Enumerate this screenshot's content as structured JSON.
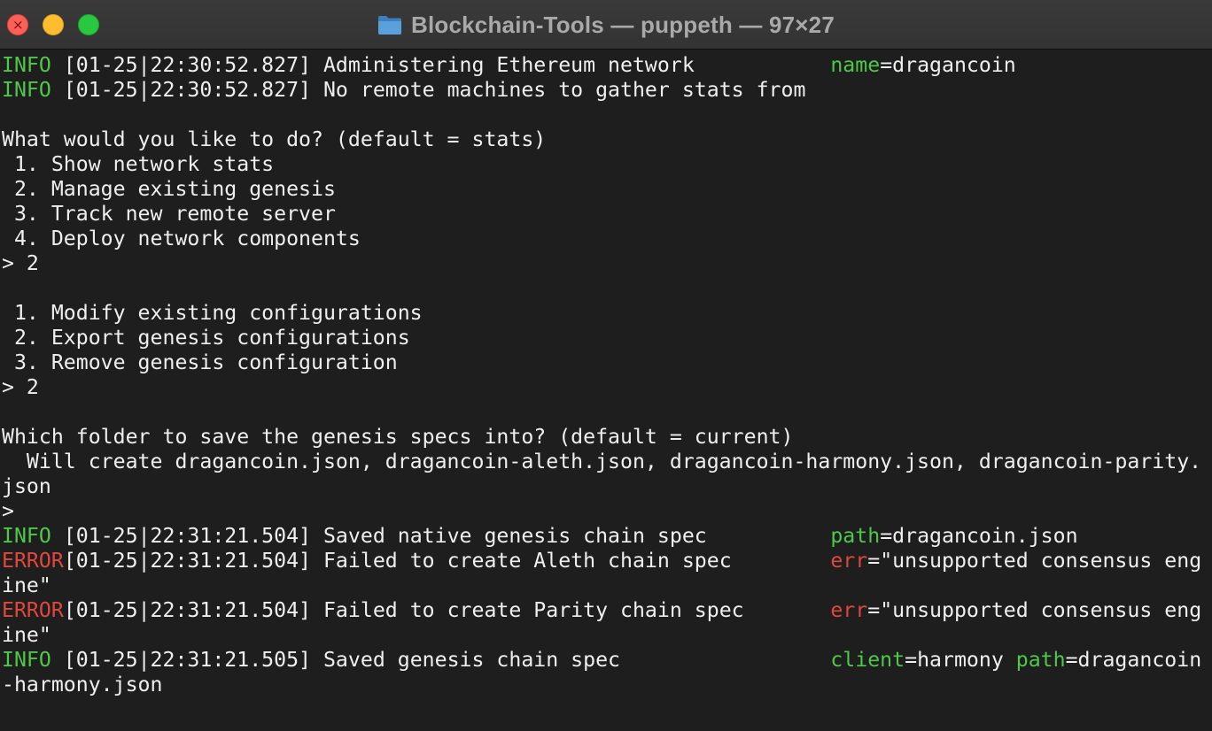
{
  "window": {
    "title": "Blockchain-Tools — puppeth — 97×27",
    "title_icon": "folder-icon",
    "close_glyph": "×"
  },
  "colors": {
    "info": "#4ec848",
    "error": "#e0483e",
    "text": "#efefef",
    "background": "#1e1e1e"
  },
  "terminal": {
    "lines": [
      {
        "level": "INFO ",
        "message": "[01-25|22:30:52.827] Administering Ethereum network           ",
        "key": "name",
        "val": "=dragancoin"
      },
      {
        "level": "INFO ",
        "message": "[01-25|22:30:52.827] No remote machines to gather stats from"
      },
      {
        "text": ""
      },
      {
        "text": "What would you like to do? (default = stats)"
      },
      {
        "text": " 1. Show network stats"
      },
      {
        "text": " 2. Manage existing genesis"
      },
      {
        "text": " 3. Track new remote server"
      },
      {
        "text": " 4. Deploy network components"
      },
      {
        "text": "> 2"
      },
      {
        "text": ""
      },
      {
        "text": " 1. Modify existing configurations"
      },
      {
        "text": " 2. Export genesis configurations"
      },
      {
        "text": " 3. Remove genesis configuration"
      },
      {
        "text": "> 2"
      },
      {
        "text": ""
      },
      {
        "text": "Which folder to save the genesis specs into? (default = current)"
      },
      {
        "text": "  Will create dragancoin.json, dragancoin-aleth.json, dragancoin-harmony.json, dragancoin-parity."
      },
      {
        "text": "json"
      },
      {
        "text": ">"
      },
      {
        "level": "INFO ",
        "message": "[01-25|22:31:21.504] Saved native genesis chain spec          ",
        "key": "path",
        "val": "=dragancoin.json"
      },
      {
        "level": "ERROR",
        "message": "[01-25|22:31:21.504] Failed to create Aleth chain spec        ",
        "key": "err",
        "val": "=\"unsupported consensus eng"
      },
      {
        "text": "ine\""
      },
      {
        "level": "ERROR",
        "message": "[01-25|22:31:21.504] Failed to create Parity chain spec       ",
        "key": "err",
        "val": "=\"unsupported consensus eng"
      },
      {
        "text": "ine\""
      },
      {
        "level": "INFO ",
        "message": "[01-25|22:31:21.505] Saved genesis chain spec                 ",
        "key": "client",
        "val": "=harmony ",
        "key2": "path",
        "val2": "=dragancoin"
      },
      {
        "text": "-harmony.json"
      }
    ]
  }
}
